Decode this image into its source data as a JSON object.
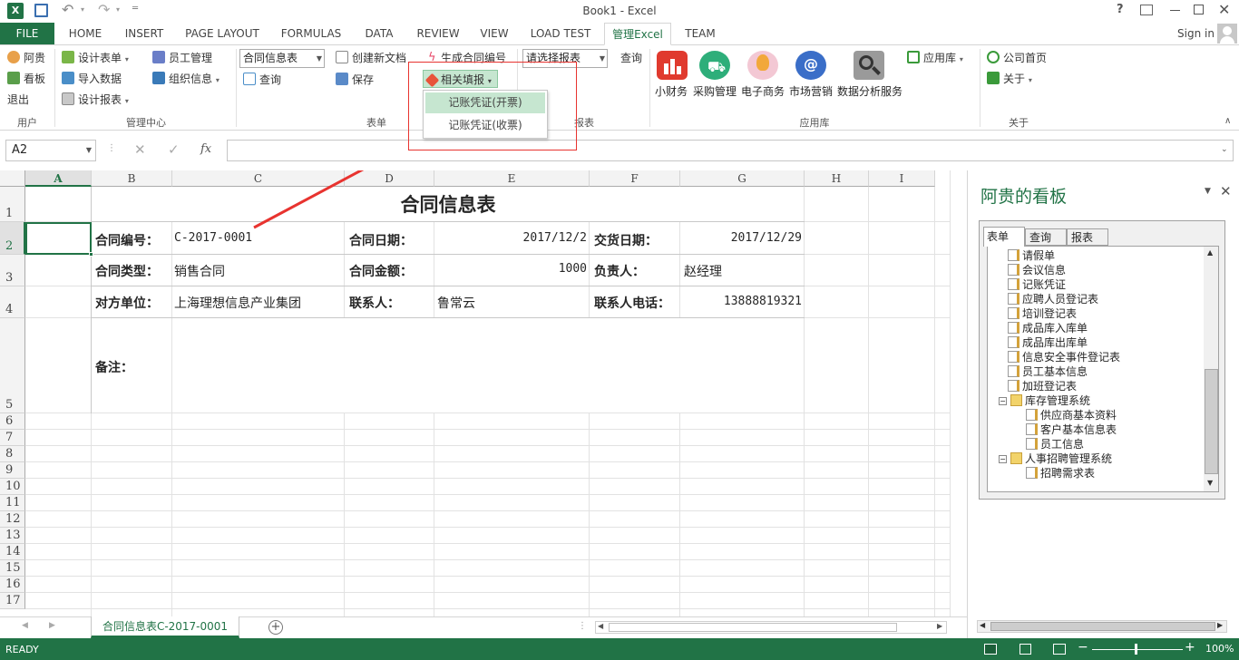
{
  "window": {
    "title": "Book1 - Excel",
    "help": "?",
    "sign_in": "Sign in"
  },
  "tabs": [
    "FILE",
    "HOME",
    "INSERT",
    "PAGE LAYOUT",
    "FORMULAS",
    "DATA",
    "REVIEW",
    "VIEW",
    "LOAD TEST",
    "管理Excel",
    "TEAM"
  ],
  "ribbon": {
    "user": {
      "items": [
        "阿贵",
        "看板",
        "退出"
      ],
      "group": "用户"
    },
    "manage": {
      "items": [
        "设计表单",
        "导入数据",
        "设计报表",
        "员工管理",
        "组织信息"
      ],
      "group": "管理中心"
    },
    "form": {
      "combo": "合同信息表",
      "query": "查询",
      "new_doc": "创建新文档",
      "save": "保存",
      "gen_no": "生成合同编号",
      "related": "相关填报",
      "group": "表单"
    },
    "report": {
      "combo": "请选择报表",
      "query": "查询",
      "group": "报表"
    },
    "apps": {
      "items": [
        "小财务",
        "采购管理",
        "电子商务",
        "市场营销",
        "数据分析服务"
      ],
      "store": "应用库",
      "group": "应用库"
    },
    "about": {
      "home": "公司首页",
      "about": "关于",
      "group": "关于"
    }
  },
  "dropdown": {
    "items": [
      "记账凭证(开票)",
      "记账凭证(收票)"
    ]
  },
  "formula_bar": {
    "name_box": "A2",
    "fx": "fx",
    "value": ""
  },
  "columns": [
    "A",
    "B",
    "C",
    "D",
    "E",
    "F",
    "G",
    "H",
    "I"
  ],
  "rows": [
    "1",
    "2",
    "3",
    "4",
    "5",
    "6",
    "7",
    "8",
    "9",
    "10",
    "11",
    "12",
    "13",
    "14",
    "15",
    "16",
    "17"
  ],
  "sheet": {
    "title": "合同信息表",
    "contract_no_label": "合同编号：",
    "contract_no": "C-2017-0001",
    "contract_date_label": "合同日期：",
    "contract_date": "2017/12/2",
    "delivery_date_label": "交货日期：",
    "delivery_date": "2017/12/29",
    "contract_type_label": "合同类型：",
    "contract_type": "销售合同",
    "amount_label": "合同金额：",
    "amount": "1000",
    "owner_label": "负责人：",
    "owner": "赵经理",
    "party_label": "对方单位：",
    "party": "上海理想信息产业集团",
    "contact_label": "联系人：",
    "contact": "鲁常云",
    "phone_label": "联系人电话：",
    "phone": "13888819321",
    "remark_label": "备注："
  },
  "panel": {
    "title": "阿贵的看板",
    "tabs": [
      "表单",
      "查询",
      "报表"
    ],
    "tree": [
      "请假单",
      "会议信息",
      "记账凭证",
      "应聘人员登记表",
      "培训登记表",
      "成品库入库单",
      "成品库出库单",
      "信息安全事件登记表",
      "员工基本信息",
      "加班登记表",
      "库存管理系统",
      "供应商基本资料",
      "客户基本信息表",
      "员工信息",
      "人事招聘管理系统",
      "招聘需求表"
    ]
  },
  "sheet_tab": "合同信息表C-2017-0001",
  "status": {
    "ready": "READY",
    "zoom": "100%"
  },
  "colors": {
    "excel_green": "#217346",
    "arrow_red": "#e8332f"
  }
}
